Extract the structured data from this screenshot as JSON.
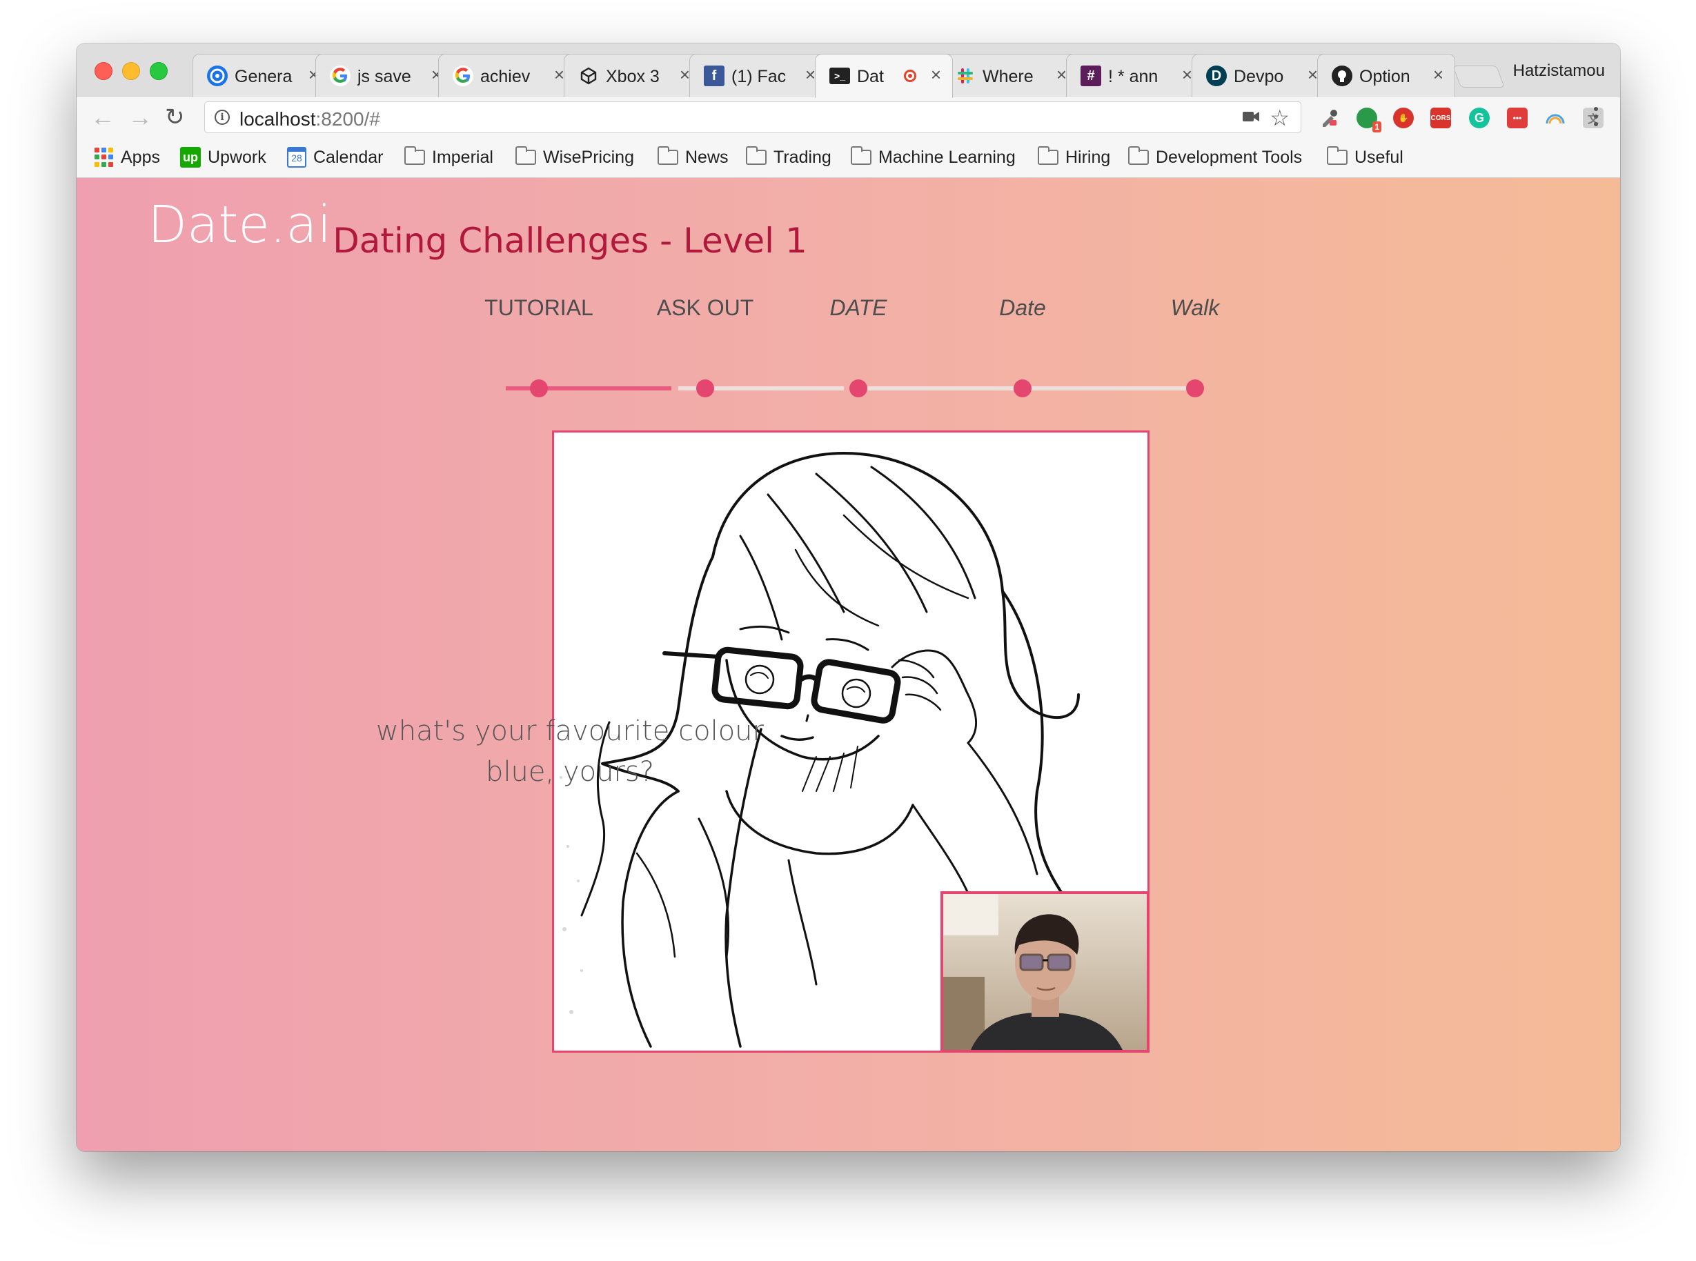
{
  "browser": {
    "profile_name": "Hatzistamou",
    "tabs": [
      {
        "title": "Genera",
        "icon": "target-icon",
        "active": false
      },
      {
        "title": "js save",
        "icon": "google-icon",
        "active": false
      },
      {
        "title": "achiev",
        "icon": "google-icon",
        "active": false
      },
      {
        "title": "Xbox 3",
        "icon": "cube-icon",
        "active": false
      },
      {
        "title": "(1) Fac",
        "icon": "facebook-icon",
        "active": false
      },
      {
        "title": "Dat",
        "icon": "terminal-icon",
        "active": true
      },
      {
        "title": "Where",
        "icon": "slack-icon",
        "active": false
      },
      {
        "title": "! * ann",
        "icon": "hash-icon",
        "active": false
      },
      {
        "title": "Devpo",
        "icon": "devpost-icon",
        "active": false
      },
      {
        "title": "Option",
        "icon": "github-icon",
        "active": false
      }
    ],
    "address": {
      "host": "localhost",
      "rest": ":8200/#"
    },
    "bookmarks": [
      {
        "label": "Apps",
        "icon": "apps-grid-icon"
      },
      {
        "label": "Upwork",
        "icon": "upwork-icon"
      },
      {
        "label": "Calendar",
        "icon": "calendar-icon",
        "day": "28"
      },
      {
        "label": "Imperial",
        "icon": "folder-icon"
      },
      {
        "label": "WisePricing",
        "icon": "folder-icon"
      },
      {
        "label": "News",
        "icon": "folder-icon"
      },
      {
        "label": "Trading",
        "icon": "folder-icon"
      },
      {
        "label": "Machine Learning",
        "icon": "folder-icon"
      },
      {
        "label": "Hiring",
        "icon": "folder-icon"
      },
      {
        "label": "Development Tools",
        "icon": "folder-icon"
      },
      {
        "label": "Useful",
        "icon": "folder-icon"
      }
    ],
    "extensions": [
      "eyedropper-icon",
      "green-extension-icon",
      "hand-stop-icon",
      "cors-icon",
      "grammarly-icon",
      "red-extension-icon",
      "rainbow-icon",
      "translate-icon",
      "globe-icon"
    ],
    "extension_texts": {
      "badge": "1",
      "cors": "CORS"
    }
  },
  "app": {
    "logo": "Date.ai",
    "title": "Dating Challenges - Level 1",
    "steps": [
      {
        "label": "TUTORIAL",
        "italic": false
      },
      {
        "label": "ASK OUT",
        "italic": false
      },
      {
        "label": "DATE",
        "italic": true
      },
      {
        "label": "Date",
        "italic": true
      },
      {
        "label": "Walk",
        "italic": true
      }
    ],
    "progress_completed_segments": 1,
    "chat": {
      "question": "what's your favourite colour",
      "answer": "blue, yours?"
    }
  },
  "colors": {
    "accent": "#e54670",
    "title": "#b0183c",
    "gradient_start": "#ef9faf",
    "gradient_end": "#f5bb97"
  }
}
